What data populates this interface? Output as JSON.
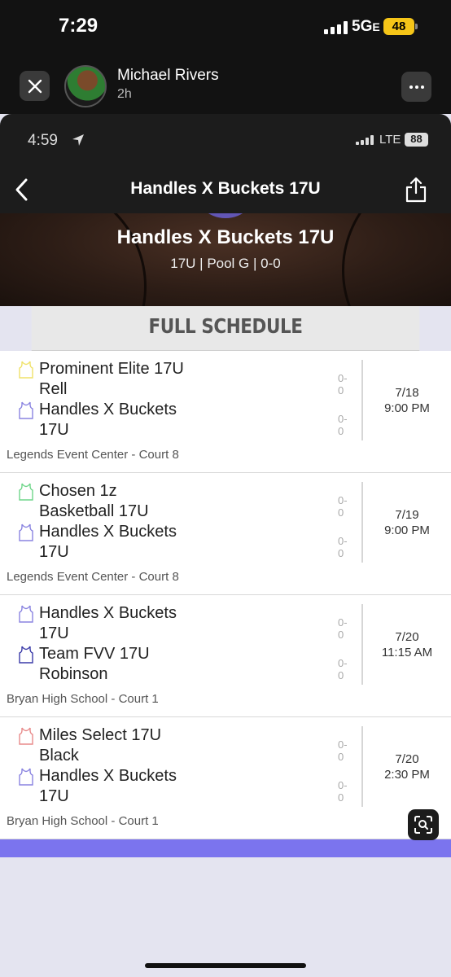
{
  "outer": {
    "time": "7:29",
    "network": "5G",
    "network_suffix": "E",
    "battery": "48",
    "user_name": "Michael Rivers",
    "posted_ago": "2h",
    "icons": [
      "close-icon",
      "avatar",
      "more-icon"
    ]
  },
  "inner": {
    "time": "4:59",
    "network": "LTE",
    "battery": "88",
    "nav_title": "Handles X Buckets 17U",
    "hero_title": "Handles X Buckets 17U",
    "hero_sub": "17U | Pool G | 0-0",
    "section_title": "FULL SCHEDULE"
  },
  "colors": {
    "accent": "#7b74ee",
    "outer_bg": "#121212",
    "battery_outer": "#f5c518"
  },
  "games": [
    {
      "team1": {
        "name": "Prominent Elite 17U Rell",
        "score": "0-0",
        "jersey_color": "#f0e26a"
      },
      "team2": {
        "name": "Handles X Buckets 17U",
        "score": "0-0",
        "jersey_color": "#8a84e0"
      },
      "date": "7/18",
      "time": "9:00 PM",
      "venue": "Legends Event Center - Court 8"
    },
    {
      "team1": {
        "name": "Chosen 1z Basketball 17U",
        "score": "0-0",
        "jersey_color": "#6fd68a"
      },
      "team2": {
        "name": "Handles X Buckets 17U",
        "score": "0-0",
        "jersey_color": "#8a84e0"
      },
      "date": "7/19",
      "time": "9:00 PM",
      "venue": "Legends Event Center - Court 8"
    },
    {
      "team1": {
        "name": "Handles X Buckets 17U",
        "score": "0-0",
        "jersey_color": "#8a84e0"
      },
      "team2": {
        "name": "Team FVV 17U Robinson",
        "score": "0-0",
        "jersey_color": "#3a3aa8"
      },
      "date": "7/20",
      "time": "11:15 AM",
      "venue": "Bryan High School - Court 1"
    },
    {
      "team1": {
        "name": "Miles Select 17U Black",
        "score": "0-0",
        "jersey_color": "#e88a8a"
      },
      "team2": {
        "name": "Handles X Buckets 17U",
        "score": "0-0",
        "jersey_color": "#8a84e0"
      },
      "date": "7/20",
      "time": "2:30 PM",
      "venue": "Bryan High School - Court 1"
    }
  ]
}
